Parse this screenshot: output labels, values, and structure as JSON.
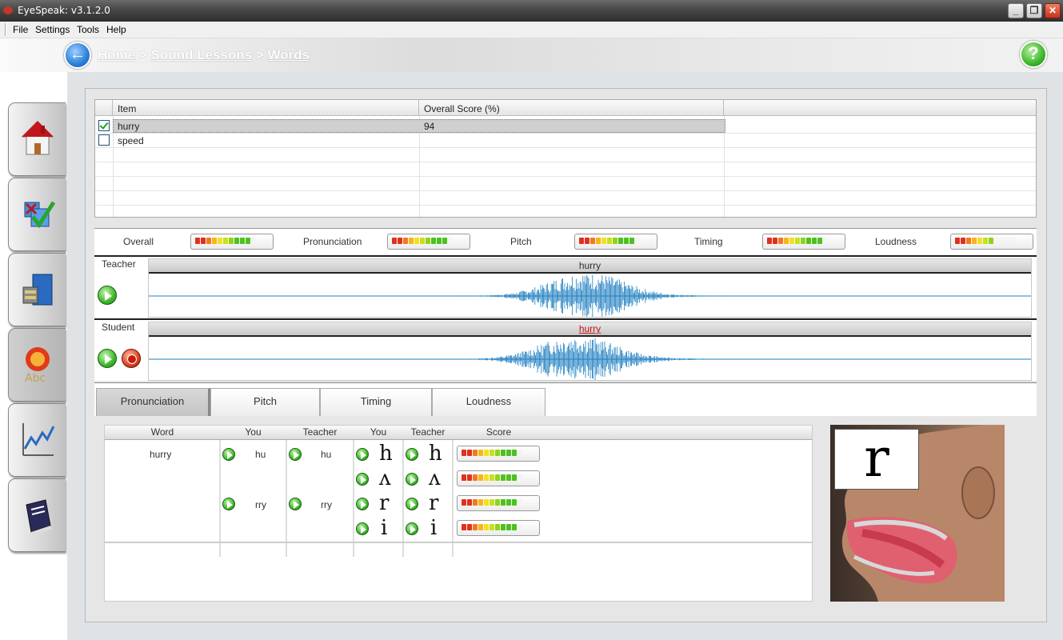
{
  "window": {
    "title": "EyeSpeak: v3.1.2.0",
    "minimize": "_",
    "restore": "❐",
    "close": "✕"
  },
  "menu": [
    "File",
    "Settings",
    "Tools",
    "Help"
  ],
  "breadcrumb": {
    "home": "Home",
    "sep": " > ",
    "lessons": "Sound Lessons",
    "current": "Words"
  },
  "buttons": {
    "back": "←",
    "help": "?"
  },
  "items_grid": {
    "headers": [
      "Item",
      "Overall Score (%)"
    ],
    "rows": [
      {
        "item": "hurry",
        "score": "94",
        "checked": true
      },
      {
        "item": "speed",
        "score": "",
        "checked": false
      }
    ]
  },
  "scores": {
    "labels": [
      "Overall",
      "Pronunciation",
      "Pitch",
      "Timing",
      "Loudness"
    ],
    "colors": [
      "#e0301e",
      "#e0301e",
      "#f07a1e",
      "#f5b51e",
      "#f5e01e",
      "#c8e01e",
      "#8ed21e",
      "#4cc21e",
      "#4cc21e",
      "#4cc21e"
    ]
  },
  "waveforms": {
    "teacher": {
      "label": "Teacher",
      "word": "hurry"
    },
    "student": {
      "label": "Student",
      "word": "hurry"
    },
    "color": "#1e7fc0"
  },
  "tabs": [
    "Pronunciation",
    "Pitch",
    "Timing",
    "Loudness"
  ],
  "pron_grid": {
    "headers": [
      "Word",
      "You",
      "Teacher",
      "You",
      "Teacher",
      "Score"
    ],
    "word": "hurry",
    "syllables": [
      {
        "you": "hu",
        "teacher": "hu"
      },
      {
        "you": "rry",
        "teacher": "rry"
      }
    ],
    "phonemes": [
      "h",
      "ʌ",
      "r",
      "i"
    ]
  },
  "mouth_letter": "r"
}
